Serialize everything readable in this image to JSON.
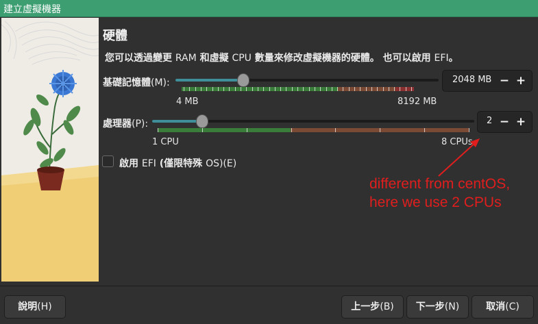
{
  "window": {
    "title": "建立虛擬機器"
  },
  "heading": "硬體",
  "description": {
    "prefix": "您可以透過變更 ",
    "ram": "RAM",
    "mid1": " 和虛擬 ",
    "cpu": "CPU",
    "mid2": " 數量來修改虛擬機器的硬體。 也可以啟用 ",
    "efi": "EFI",
    "suffix": "。"
  },
  "memory": {
    "label_a": "基礎記憶體",
    "label_b": "(M):",
    "value": "2048 MB",
    "min_label": "4 MB",
    "max_label": "8192 MB",
    "fraction": 0.25,
    "minus": "−",
    "plus": "+"
  },
  "processor": {
    "label_a": "處理器",
    "label_b": "(P):",
    "value": "2",
    "min_label": "1 CPU",
    "max_label": "8 CPUs",
    "fraction": 0.143,
    "minus": "−",
    "plus": "+"
  },
  "efi_checkbox": {
    "label_a": "啟用 ",
    "label_b": "EFI",
    "label_c": " (僅限特殊 ",
    "label_d": "OS)(E)",
    "checked": false
  },
  "annotation": {
    "line1": "different from centOS,",
    "line2": "here we use 2 CPUs",
    "color": "#e01e1e"
  },
  "buttons": {
    "help_a": "說明",
    "help_b": "(H)",
    "back_a": "上一步",
    "back_b": "(B)",
    "next_a": "下一步",
    "next_b": "(N)",
    "cancel_a": "取消",
    "cancel_b": "(C)"
  },
  "colors": {
    "titlebar": "#3d9e72",
    "slider_fill": "#3f8f9a",
    "bar_green": "#3a7d3a",
    "bar_brown": "#7a4a35",
    "bar_red": "#8a3030"
  },
  "icons": [
    "minus-icon",
    "plus-icon",
    "arrow-annotation"
  ]
}
